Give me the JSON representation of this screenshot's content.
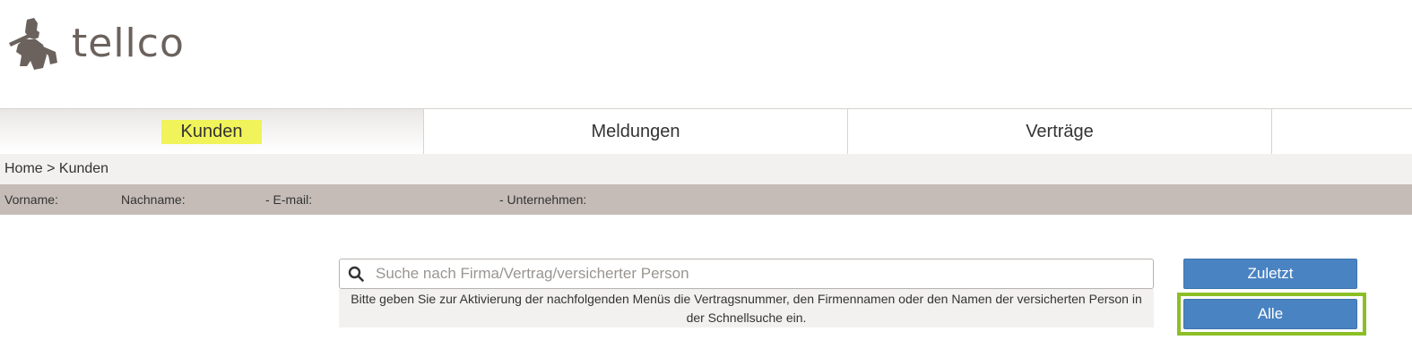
{
  "header": {
    "logo_text": "tellco",
    "logo_icon": "tell-figure-logo"
  },
  "nav": {
    "items": [
      {
        "label": "Kunden",
        "active": true
      },
      {
        "label": "Meldungen",
        "active": false
      },
      {
        "label": "Verträge",
        "active": false
      },
      {
        "label": "",
        "active": false
      }
    ]
  },
  "breadcrumb": {
    "text": "Home > Kunden"
  },
  "infobar": {
    "vorname_label": "Vorname:",
    "nachname_label": "Nachname:",
    "email_label": "- E-mail:",
    "unternehmen_label": "- Unternehmen:"
  },
  "search": {
    "icon": "search-icon",
    "placeholder": "Suche nach Firma/Vertrag/versicherter Person",
    "value": "",
    "hint": "Bitte geben Sie zur Aktivierung der nachfolgenden Menüs die Vertragsnummer, den Firmennamen oder den Namen der versicherten Person in der Schnellsuche ein."
  },
  "buttons": {
    "recent_label": "Zuletzt",
    "all_label": "Alle"
  },
  "colors": {
    "primary_button": "#4a83c2",
    "highlight_yellow": "#f0f35a",
    "focus_green": "#8cbf26",
    "infobar_bg": "#c5bcb8"
  }
}
